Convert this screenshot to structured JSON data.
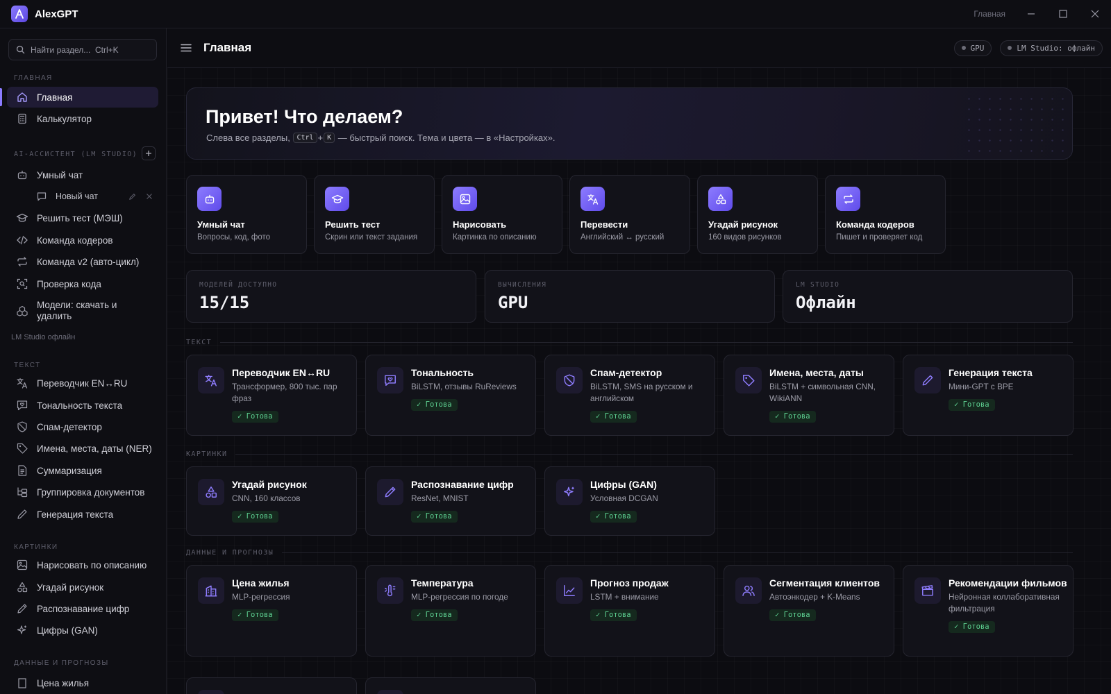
{
  "window": {
    "app_title": "AlexGPT",
    "breadcrumb": "Главная"
  },
  "sidebar": {
    "search_placeholder": "Найти раздел...  Ctrl+K",
    "sections": {
      "main": "ГЛАВНАЯ",
      "ai": "AI-АССИСТЕНТ (LM STUDIO)",
      "text": "ТЕКСТ",
      "images": "КАРТИНКИ",
      "data": "ДАННЫЕ И ПРОГНОЗЫ"
    },
    "main_items": [
      "Главная",
      "Калькулятор"
    ],
    "ai_items": [
      "Умный чат",
      "Решить тест (МЭШ)",
      "Команда кодеров",
      "Команда v2 (авто-цикл)",
      "Проверка кода",
      "Модели: скачать и удалить"
    ],
    "new_chat": "Новый чат",
    "lm_status": "LM Studio офлайн",
    "text_items": [
      "Переводчик EN↔RU",
      "Тональность текста",
      "Спам-детектор",
      "Имена, места, даты (NER)",
      "Суммаризация",
      "Группировка документов",
      "Генерация текста"
    ],
    "image_items": [
      "Нарисовать по описанию",
      "Угадай рисунок",
      "Распознавание цифр",
      "Цифры (GAN)"
    ],
    "data_items": [
      "Цена жилья"
    ]
  },
  "topbar": {
    "title": "Главная",
    "gpu_pill": "GPU",
    "lm_pill": "LM Studio: офлайн"
  },
  "hero": {
    "title": "Привет! Что делаем?",
    "sub_before": "Слева все разделы,",
    "kbd1": "Ctrl",
    "plus": "+",
    "kbd2": "K",
    "sub_after": "— быстрый поиск. Тема и цвета — в «Настройках»."
  },
  "quick_actions": [
    {
      "title": "Умный чат",
      "sub": "Вопросы, код, фото",
      "icon": "bot-icon"
    },
    {
      "title": "Решить тест",
      "sub": "Скрин или текст задания",
      "icon": "graduation-cap-icon"
    },
    {
      "title": "Нарисовать",
      "sub": "Картинка по описанию",
      "icon": "image-icon"
    },
    {
      "title": "Перевести",
      "sub": "Английский ↔ русский",
      "icon": "translate-icon"
    },
    {
      "title": "Угадай рисунок",
      "sub": "160 видов рисунков",
      "icon": "shapes-icon"
    },
    {
      "title": "Команда кодеров",
      "sub": "Пишет и проверяет код",
      "icon": "repeat-icon"
    }
  ],
  "stats": [
    {
      "label": "МОДЕЛЕЙ ДОСТУПНО",
      "value": "15/15"
    },
    {
      "label": "ВЫЧИСЛЕНИЯ",
      "value": "GPU"
    },
    {
      "label": "LM STUDIO",
      "value": "Офлайн"
    }
  ],
  "sections": {
    "text": "ТЕКСТ",
    "images": "КАРТИНКИ",
    "data": "ДАННЫЕ И ПРОГНОЗЫ"
  },
  "badge_ready": "✓ Готова",
  "text_cards": [
    {
      "title": "Переводчик EN↔RU",
      "sub": "Трансформер, 800 тыс. пар фраз"
    },
    {
      "title": "Тональность",
      "sub": "BiLSTM, отзывы RuReviews"
    },
    {
      "title": "Спам-детектор",
      "sub": "BiLSTM, SMS на русском и английском"
    },
    {
      "title": "Имена, места, даты",
      "sub": "BiLSTM + символьная CNN, WikiANN"
    },
    {
      "title": "Генерация текста",
      "sub": "Мини-GPT с BPE"
    }
  ],
  "image_cards": [
    {
      "title": "Угадай рисунок",
      "sub": "CNN, 160 классов"
    },
    {
      "title": "Распознавание цифр",
      "sub": "ResNet, MNIST"
    },
    {
      "title": "Цифры (GAN)",
      "sub": "Условная DCGAN"
    }
  ],
  "data_cards": [
    {
      "title": "Цена жилья",
      "sub": "MLP-регрессия"
    },
    {
      "title": "Температура",
      "sub": "MLP-регрессия по погоде"
    },
    {
      "title": "Прогноз продаж",
      "sub": "LSTM + внимание"
    },
    {
      "title": "Сегментация клиентов",
      "sub": "Автоэнкодер + K-Means"
    },
    {
      "title": "Рекомендации фильмов",
      "sub": "Нейронная коллаборативная фильтрация"
    }
  ]
}
